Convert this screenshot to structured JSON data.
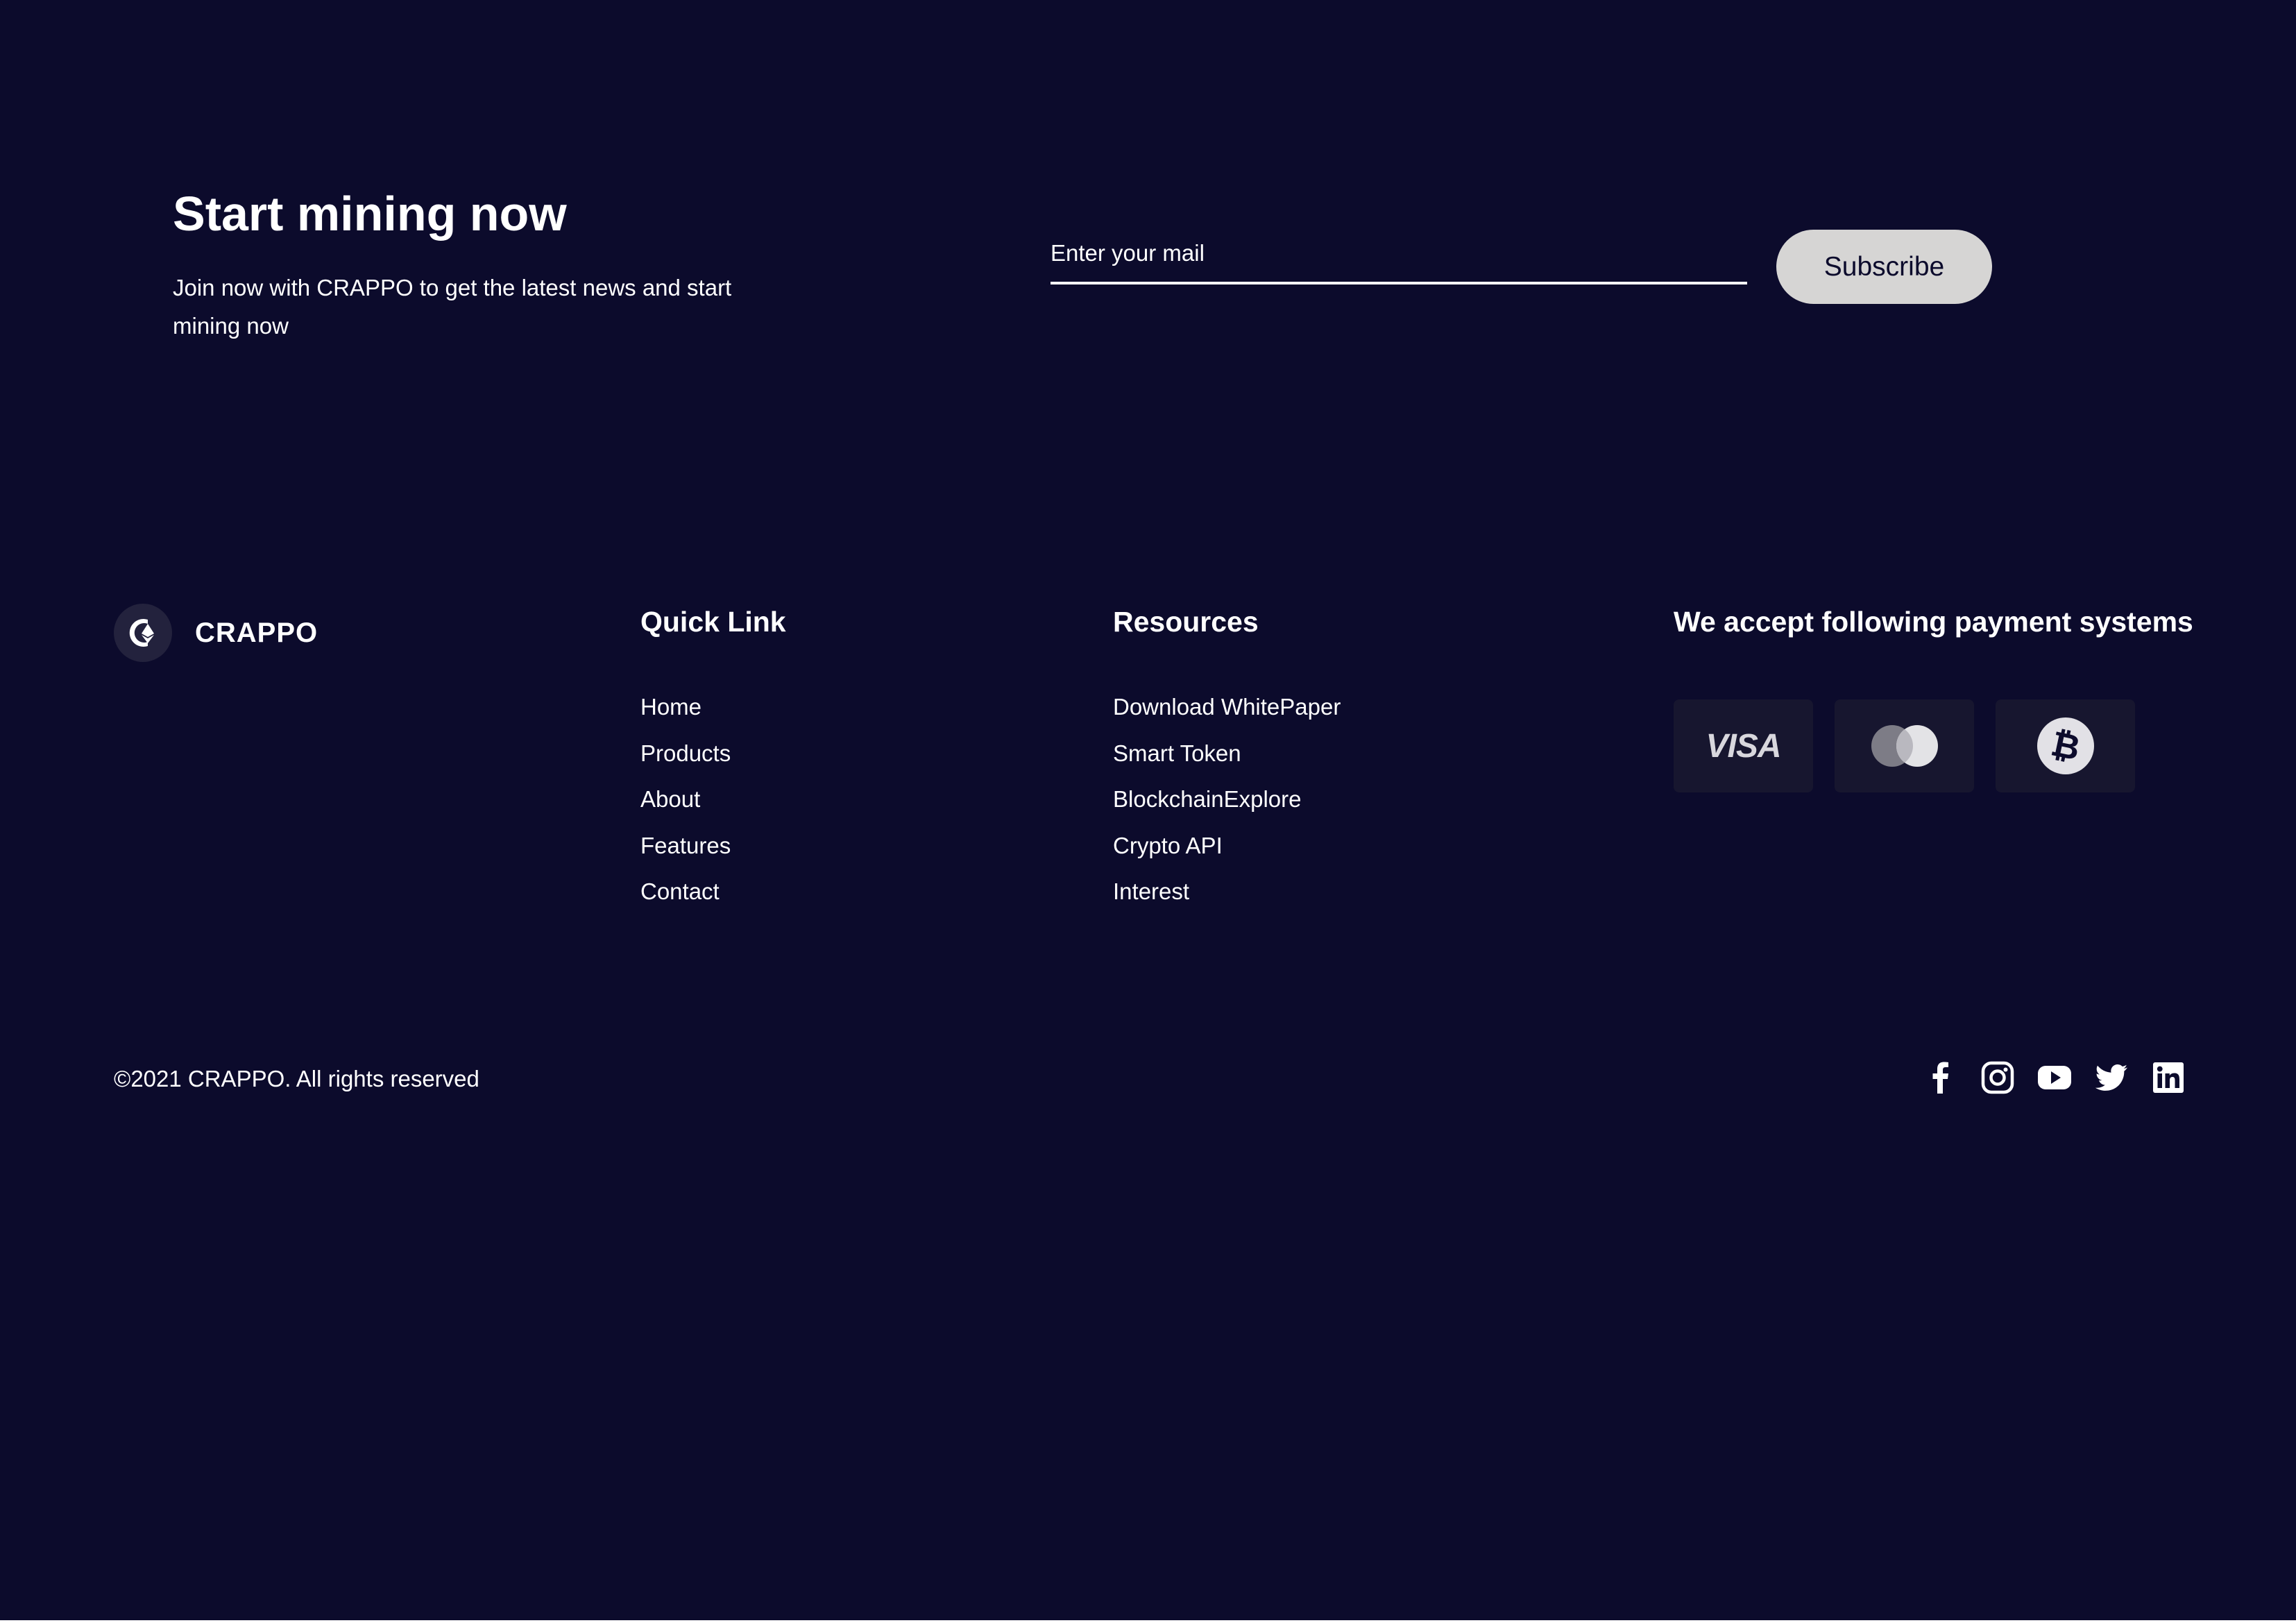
{
  "cta": {
    "title": "Start mining now",
    "subtitle": "Join now with CRAPPO to get the latest news and start mining now",
    "email_placeholder": "Enter your mail",
    "subscribe_label": "Subscribe"
  },
  "brand": {
    "name": "CRAPPO",
    "logo_icon": "crappo-logo-icon"
  },
  "quick_links": {
    "heading": "Quick Link",
    "items": [
      "Home",
      "Products",
      "About",
      "Features",
      "Contact"
    ]
  },
  "resources": {
    "heading": "Resources",
    "items": [
      "Download WhitePaper",
      "Smart Token",
      "BlockchainExplore",
      "Crypto API",
      "Interest"
    ]
  },
  "payments": {
    "heading": "We accept following payment systems",
    "methods": [
      {
        "name": "visa",
        "text": "VISA",
        "icon": "visa-icon"
      },
      {
        "name": "mastercard",
        "icon": "mastercard-icon"
      },
      {
        "name": "bitcoin",
        "icon": "bitcoin-icon"
      }
    ]
  },
  "footer": {
    "copyright": "©2021 CRAPPO. All rights reserved",
    "social": [
      "facebook-icon",
      "instagram-icon",
      "youtube-icon",
      "twitter-icon",
      "linkedin-icon"
    ]
  },
  "colors": {
    "background": "#0c0b2c",
    "text": "#ffffff",
    "button_bg": "#d6d5d4",
    "card_bg": "#17162f"
  }
}
